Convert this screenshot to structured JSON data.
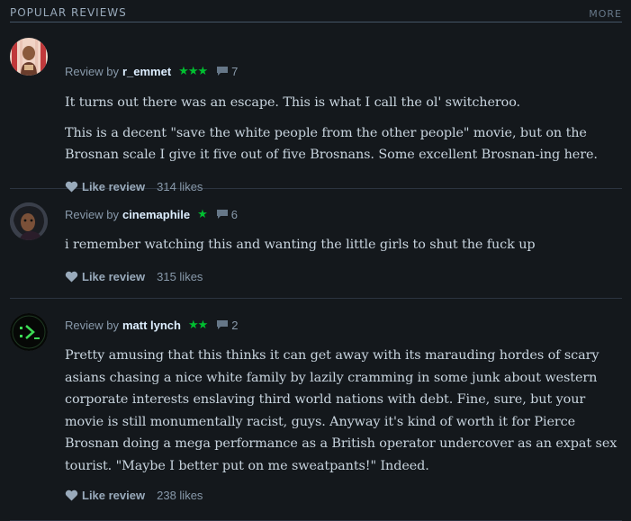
{
  "section": {
    "title": "POPULAR REVIEWS",
    "more": "MORE"
  },
  "colors": {
    "accent_green": "#00c030",
    "background": "#14181c",
    "text": "#c8d4de"
  },
  "reviews": [
    {
      "prefix": "Review by",
      "author": "r_emmet",
      "rating_stars": "★★★",
      "rating": 3,
      "comments": "7",
      "paragraphs": [
        "It turns out there was an escape. This is what I call the ol' switcheroo.",
        "This is a decent \"save the white people from the other people\" movie, but on the Brosnan scale I give it five out of five Brosnans. Some excellent Brosnan-ing here."
      ],
      "like_label": "Like review",
      "likes": "314 likes"
    },
    {
      "prefix": "Review by",
      "author": "cinemaphile",
      "rating_stars": "★",
      "rating": 1,
      "comments": "6",
      "paragraphs": [
        "i remember watching this and wanting the little girls to shut the fuck up"
      ],
      "like_label": "Like review",
      "likes": "315 likes"
    },
    {
      "prefix": "Review by",
      "author": "matt lynch",
      "rating_stars": "★★",
      "rating": 2,
      "comments": "2",
      "paragraphs": [
        "Pretty amusing that this thinks it can get away with its marauding hordes of scary asians chasing a nice white family by lazily cramming in some junk about western corporate interests enslaving third world nations with debt. Fine, sure, but your movie is still monumentally racist, guys. Anyway it's kind of worth it for Pierce Brosnan doing a mega performance as a British operator undercover as an expat sex tourist. \"Maybe I better put on me sweatpants!\" Indeed."
      ],
      "like_label": "Like review",
      "likes": "238 likes"
    }
  ]
}
